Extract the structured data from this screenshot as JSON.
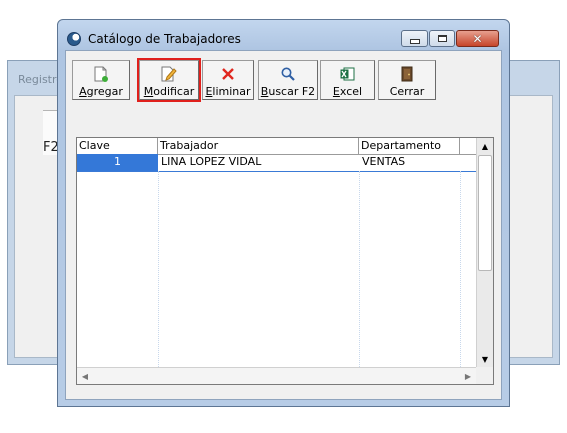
{
  "background_window": {
    "title": "Registro",
    "f2_label": "F2"
  },
  "window": {
    "title": "Catálogo de Trabajadores",
    "controls": {
      "minimize": "minimize-icon",
      "maximize": "maximize-icon",
      "close": "close-icon"
    }
  },
  "toolbar": {
    "buttons": [
      {
        "key": "A",
        "rest": "gregar",
        "icon": "document-add-icon"
      },
      {
        "key": "M",
        "rest": "odificar",
        "icon": "document-edit-icon",
        "highlighted": true
      },
      {
        "key": "E",
        "rest": "liminar",
        "icon": "delete-x-icon"
      },
      {
        "key": "B",
        "rest": "uscar F2",
        "icon": "magnifier-icon"
      },
      {
        "key": "E",
        "rest": "xcel",
        "icon": "excel-icon"
      },
      {
        "key": "",
        "rest": "Cerrar",
        "icon": "door-exit-icon"
      }
    ],
    "highlight_color": "#e0201c"
  },
  "grid": {
    "columns": [
      "Clave",
      "Trabajador",
      "Departamento"
    ],
    "rows": [
      {
        "clave": "1",
        "trabajador": "LINA LOPEZ VIDAL",
        "departamento": "VENTAS"
      }
    ],
    "selection_color": "#3478d8"
  }
}
